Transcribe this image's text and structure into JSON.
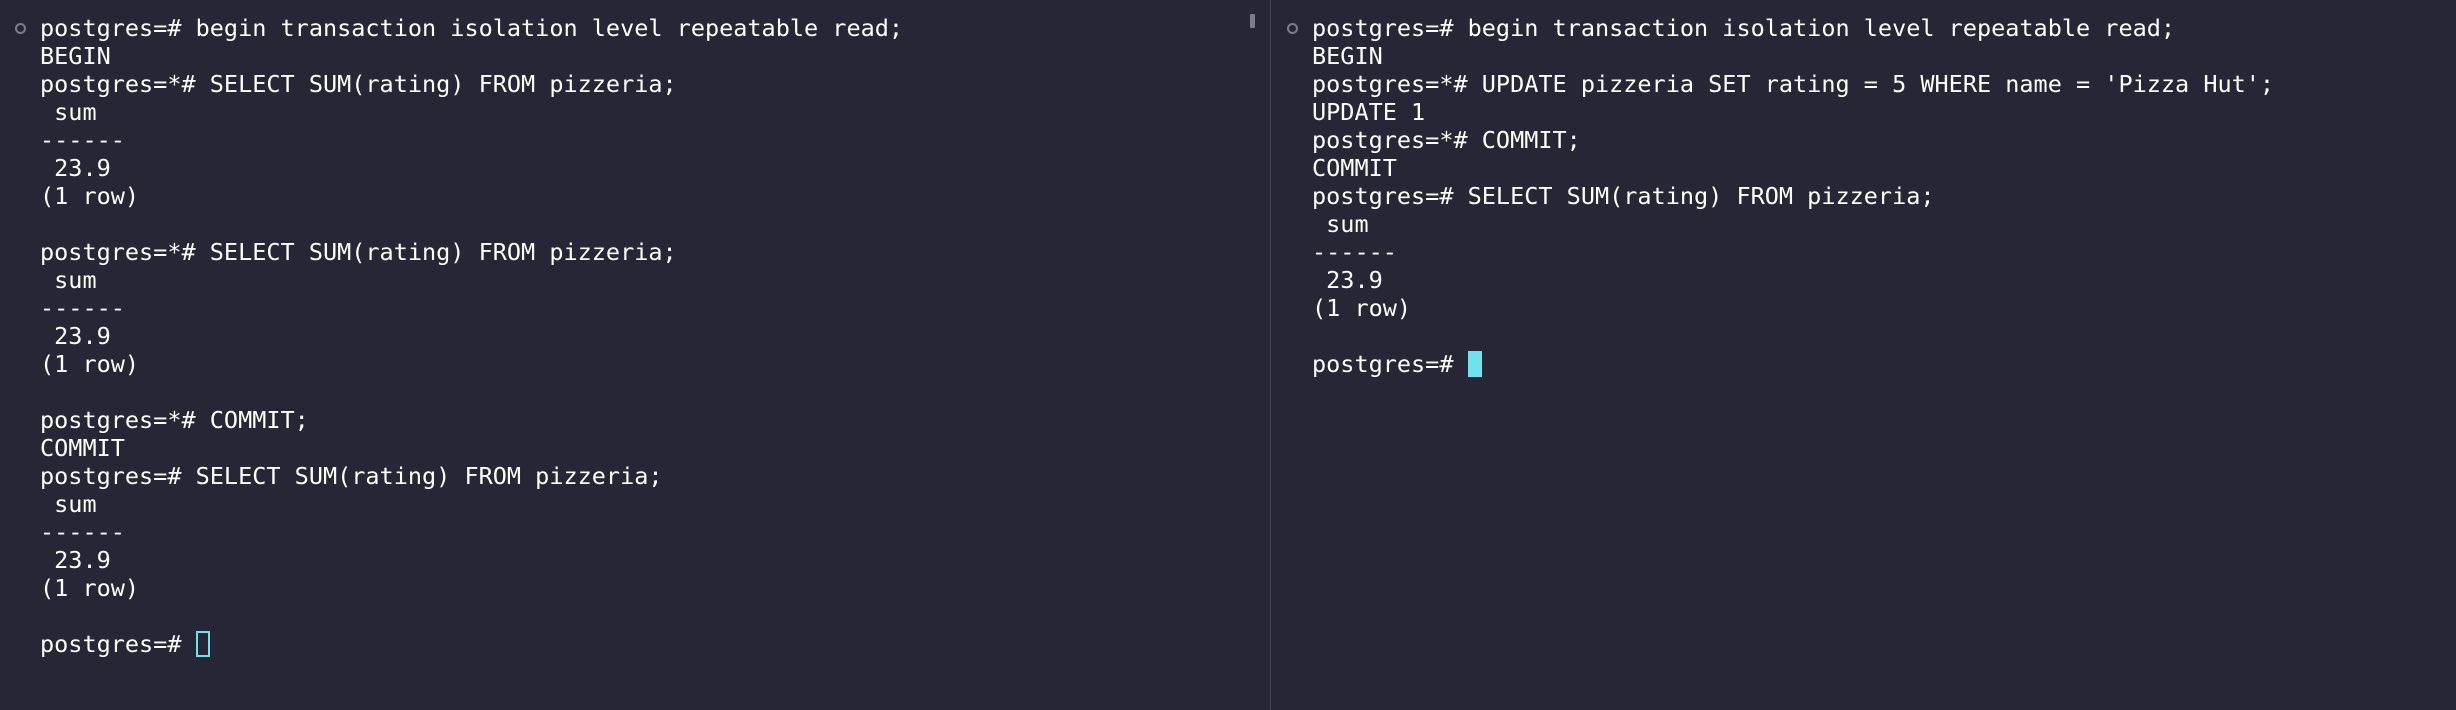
{
  "theme": {
    "background": "#272636",
    "foreground": "#ffffff",
    "cursor_color": "#6fe3ec",
    "divider_color": "#45445a"
  },
  "left_pane": {
    "lines": [
      "postgres=# begin transaction isolation level repeatable read;",
      "BEGIN",
      "postgres=*# SELECT SUM(rating) FROM pizzeria;",
      " sum",
      "------",
      " 23.9",
      "(1 row)",
      "",
      "postgres=*# SELECT SUM(rating) FROM pizzeria;",
      " sum",
      "------",
      " 23.9",
      "(1 row)",
      "",
      "postgres=*# COMMIT;",
      "COMMIT",
      "postgres=# SELECT SUM(rating) FROM pizzeria;",
      " sum",
      "------",
      " 23.9",
      "(1 row)",
      "",
      "postgres=# "
    ],
    "cursor_style": "hollow"
  },
  "right_pane": {
    "lines": [
      "postgres=# begin transaction isolation level repeatable read;",
      "BEGIN",
      "postgres=*# UPDATE pizzeria SET rating = 5 WHERE name = 'Pizza Hut';",
      "UPDATE 1",
      "postgres=*# COMMIT;",
      "COMMIT",
      "postgres=# SELECT SUM(rating) FROM pizzeria;",
      " sum",
      "------",
      " 23.9",
      "(1 row)",
      "",
      "postgres=# "
    ],
    "cursor_style": "solid"
  }
}
